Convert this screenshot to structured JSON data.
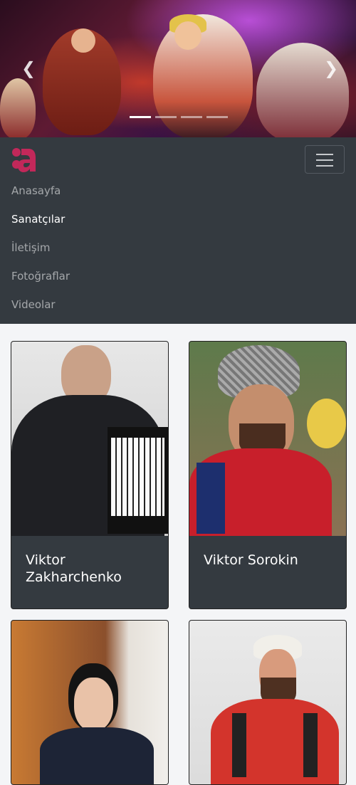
{
  "carousel": {
    "slide_count": 4,
    "active_index": 0
  },
  "brand": {
    "logo": "a",
    "accent": "#d63367"
  },
  "nav": {
    "items": [
      {
        "label": "Anasayfa",
        "active": false
      },
      {
        "label": "Sanatçılar",
        "active": true
      },
      {
        "label": "İletişim",
        "active": false
      },
      {
        "label": "Fotoğraflar",
        "active": false
      },
      {
        "label": "Videolar",
        "active": false
      }
    ]
  },
  "artists": [
    {
      "name": "Viktor Zakharchenko"
    },
    {
      "name": "Viktor Sorokin"
    },
    {
      "name": ""
    },
    {
      "name": ""
    }
  ],
  "colors": {
    "navbar": "#343a40",
    "page": "#f4f5f7"
  }
}
